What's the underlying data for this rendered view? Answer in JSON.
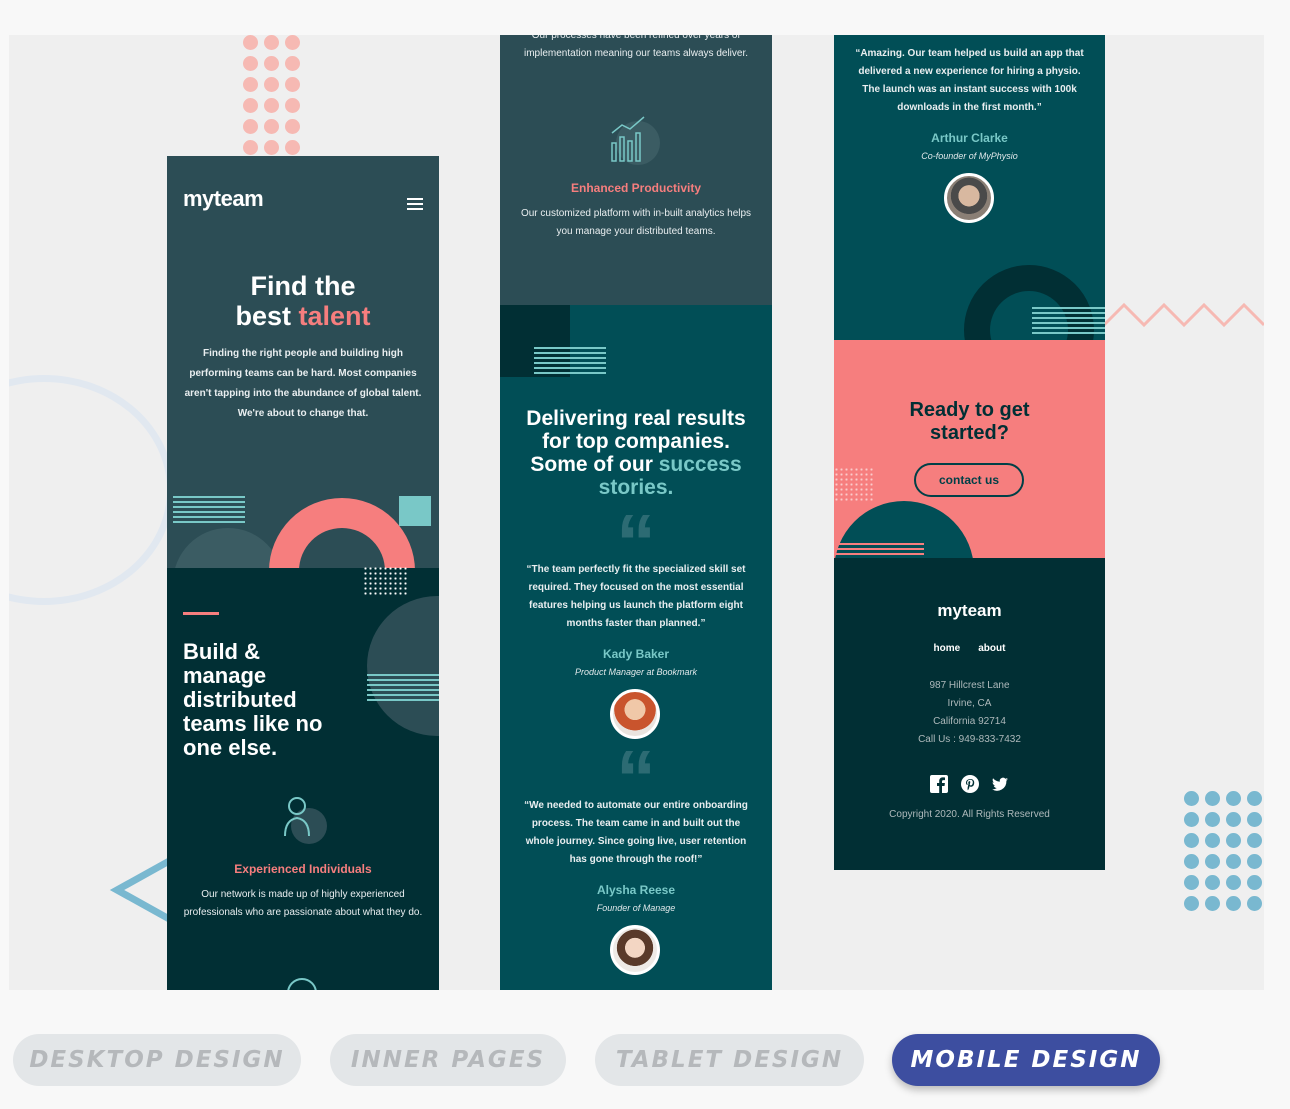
{
  "phone1": {
    "logo": "myteam",
    "hero_title_line1": "Find the",
    "hero_title_line2_a": "best ",
    "hero_title_line2_b": "talent",
    "hero_text": "Finding the right people and building high performing teams can be hard. Most companies aren't tapping into the abundance of global talent. We're about to change that.",
    "section_title": "Build & manage distributed teams like no one else.",
    "feature_title": "Experienced Individuals",
    "feature_text": "Our network is made up of highly experienced professionals who are passionate about what they do."
  },
  "phone2": {
    "top_text": "Our processes have been refined over years of implementation meaning our teams always deliver.",
    "feature_title": "Enhanced Productivity",
    "feature_text": "Our customized platform with in-built analytics helps you manage your distributed teams.",
    "results_title_a": "Delivering real results for top companies. Some of our ",
    "results_title_b": "success stories.",
    "quote1": "“The team perfectly fit the specialized skill set required. They focused on the most essential features helping us launch the platform eight months faster than planned.”",
    "name1": "Kady Baker",
    "role1": "Product Manager at Bookmark",
    "quote2": "“We needed to automate our entire onboarding process. The team came in and built out the whole journey. Since going live, user retention has gone through the roof!”",
    "name2": "Alysha Reese",
    "role2": "Founder of Manage"
  },
  "phone3": {
    "quote": "“Amazing. Our team helped us build an app that delivered a new experience for hiring a physio. The launch was an instant success with 100k downloads in the first month.”",
    "name": "Arthur Clarke",
    "role": "Co-founder of MyPhysio",
    "cta_title": "Ready to get started?",
    "cta_button": "contact us",
    "footer_logo": "myteam",
    "nav_home": "home",
    "nav_about": "about",
    "address1": "987  Hillcrest Lane",
    "address2": "Irvine, CA",
    "address3": "California 92714",
    "phone": "Call Us : 949-833-7432",
    "copyright": "Copyright 2020. All Rights Reserved",
    "social_icons": [
      "facebook-icon",
      "pinterest-icon",
      "twitter-icon"
    ]
  },
  "tabs": [
    {
      "label": "DESKTOP DESIGN",
      "active": false
    },
    {
      "label": "INNER PAGES",
      "active": false
    },
    {
      "label": "TABLET DESIGN",
      "active": false
    },
    {
      "label": "MOBILE DESIGN",
      "active": true
    }
  ],
  "colors": {
    "dark_teal": "#2c4d55",
    "darker_teal": "#014e56",
    "footer": "#012f34",
    "coral": "#f67e7e",
    "mint": "#79c8c7",
    "active_tab": "#3d4ea0",
    "inactive_tab": "#e3e6e8"
  }
}
